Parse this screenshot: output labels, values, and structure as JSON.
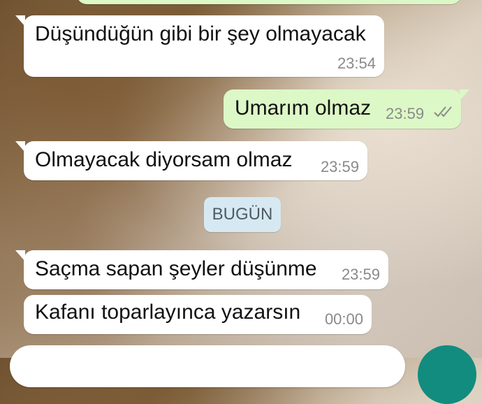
{
  "messages": [
    {
      "direction": "in",
      "text": "Düşündüğün gibi bir şey olmayacak",
      "time": "23:54"
    },
    {
      "direction": "out",
      "text": "Umarım olmaz",
      "time": "23:59",
      "status": "read-double-check"
    },
    {
      "direction": "in",
      "text": "Olmayacak diyorsam olmaz",
      "time": "23:59"
    },
    {
      "direction": "in",
      "text": "Saçma sapan şeyler düşünme",
      "time": "23:59"
    },
    {
      "direction": "in",
      "text": "Kafanı toparlayınca yazarsın",
      "time": "00:00"
    }
  ],
  "date_separator": "BUGÜN",
  "colors": {
    "incoming_bubble": "#ffffff",
    "outgoing_bubble": "#dcf8c6",
    "timestamp": "#8a8a8a",
    "date_chip": "#d6e9f2",
    "send_button": "#128c7e"
  },
  "icons": {
    "read_status": "double-check-icon",
    "send": "send-icon"
  }
}
